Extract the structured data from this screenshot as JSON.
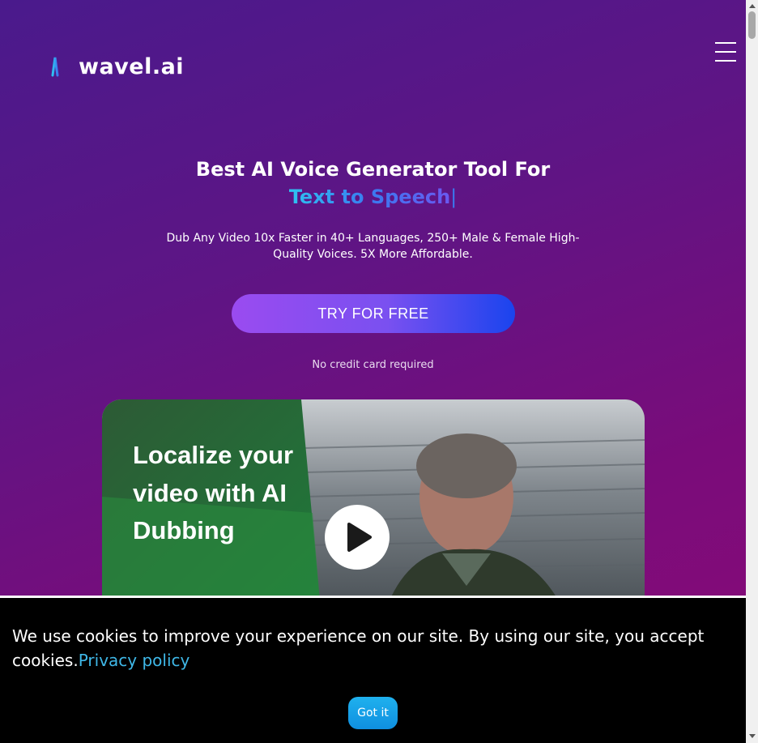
{
  "header": {
    "logo_text": "wavel.ai",
    "logo_icon": "soundwave-logo-icon",
    "menu_icon": "hamburger-menu-icon"
  },
  "hero": {
    "title_line1": "Best AI Voice Generator Tool For",
    "title_line2": "Text to Speech",
    "caret": "|",
    "subtitle": "Dub Any Video 10x Faster in 40+ Languages, 250+ Male & Female High-Quality Voices. 5X More Affordable.",
    "cta_label": "TRY FOR FREE",
    "note": "No credit card required"
  },
  "video": {
    "overlay_text": "Localize your video with AI Dubbing",
    "play_icon": "play-icon"
  },
  "cookie_banner": {
    "message": "We use cookies to improve your experience on our site. By using our site, you accept cookies.",
    "policy_link": "Privacy policy",
    "accept_label": "Got it"
  },
  "colors": {
    "bg_top": "#4a1a8c",
    "bg_bottom": "#8a0a78",
    "accent_blue": "#3a7af0",
    "link": "#3fb8e8",
    "cta_start": "#9a4bf0",
    "cta_end": "#1a44ee"
  }
}
